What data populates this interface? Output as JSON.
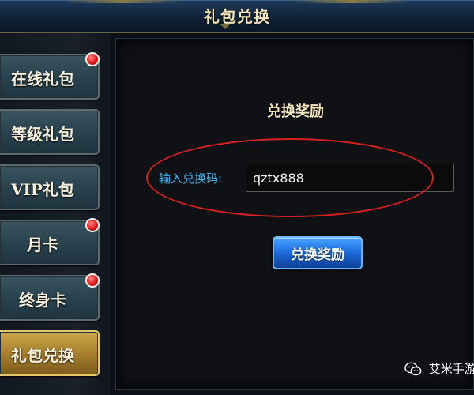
{
  "window": {
    "title": "礼包兑换"
  },
  "sidebar": {
    "tabs": [
      {
        "label": "在线礼包",
        "has_badge": true,
        "active": false
      },
      {
        "label": "等级礼包",
        "has_badge": false,
        "active": false
      },
      {
        "label": "VIP礼包",
        "has_badge": false,
        "active": false
      },
      {
        "label": "月卡",
        "has_badge": true,
        "active": false
      },
      {
        "label": "终身卡",
        "has_badge": true,
        "active": false
      },
      {
        "label": "礼包兑换",
        "has_badge": false,
        "active": true
      }
    ]
  },
  "main": {
    "heading": "兑换奖励",
    "code_label": "输入兑换码:",
    "code_value": "qztx888",
    "redeem_button": "兑换奖励"
  },
  "watermark": {
    "text": "艾米手游",
    "icon": "wechat-icon"
  },
  "colors": {
    "label_blue": "#3fb4f0",
    "highlight_red": "#d82020",
    "active_tab_gold": "#cfa94c",
    "badge_red": "#e01818"
  }
}
